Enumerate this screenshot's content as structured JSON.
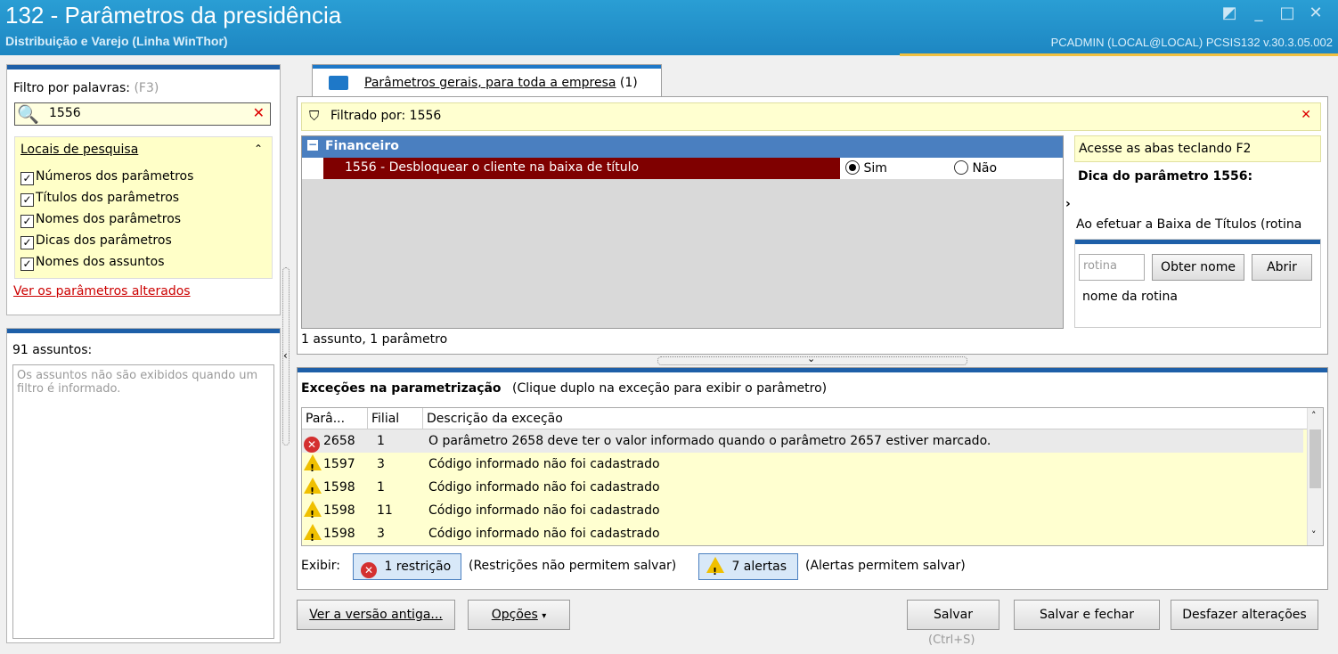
{
  "window": {
    "title": "132 - Parâmetros da presidência",
    "subtitle": "Distribuição e Varejo (Linha WinThor)",
    "user_info": "PCADMIN (LOCAL@LOCAL)   PCSIS132  v.30.3.05.002"
  },
  "filter": {
    "label": "Filtro por palavras:",
    "shortcut": "(F3)",
    "value": "1556",
    "search_places_label": "Locais de pesquisa",
    "options": [
      {
        "label": "Números dos parâmetros",
        "checked": true
      },
      {
        "label": "Títulos dos parâmetros",
        "checked": true
      },
      {
        "label": "Nomes dos parâmetros",
        "checked": true
      },
      {
        "label": "Dicas dos parâmetros",
        "checked": true
      },
      {
        "label": "Nomes dos assuntos",
        "checked": true
      }
    ],
    "changed_link": "Ver os parâmetros alterados"
  },
  "subjects": {
    "count_label": "91 assuntos:",
    "message": "Os assuntos não são exibidos quando um filtro é informado."
  },
  "tab": {
    "label": "Parâmetros gerais, para toda a empresa",
    "count": "(1)"
  },
  "filterbar": {
    "text": "Filtrado por: 1556"
  },
  "tree": {
    "group": "Financeiro",
    "param_label": "1556 - Desbloquear o cliente na baixa de título",
    "yes": "Sim",
    "no": "Não",
    "status": "1 assunto, 1 parâmetro"
  },
  "hint": {
    "tabs_hint": "Acesse as abas teclando F2",
    "title": "Dica do parâmetro 1556:",
    "text": "Ao efetuar a Baixa de Títulos (rotina",
    "routine_placeholder": "rotina",
    "get_name_button": "Obter nome",
    "open_button": "Abrir",
    "routine_name": "nome da rotina"
  },
  "exceptions": {
    "title": "Exceções na parametrização",
    "subtitle": "(Clique duplo na exceção para exibir o parâmetro)",
    "columns": [
      "Parâ...",
      "Filial",
      "Descrição da exceção"
    ],
    "rows": [
      {
        "type": "error",
        "param": "2658",
        "filial": "1",
        "desc": "O parâmetro 2658 deve ter o valor informado quando o parâmetro 2657 estiver marcado."
      },
      {
        "type": "warning",
        "param": "1597",
        "filial": "3",
        "desc": "Código informado não foi cadastrado"
      },
      {
        "type": "warning",
        "param": "1598",
        "filial": "1",
        "desc": "Código informado não foi cadastrado"
      },
      {
        "type": "warning",
        "param": "1598",
        "filial": "11",
        "desc": "Código informado não foi cadastrado"
      },
      {
        "type": "warning",
        "param": "1598",
        "filial": "3",
        "desc": "Código informado não foi cadastrado"
      }
    ],
    "show_label": "Exibir:",
    "restrictions_button": "1 restrição",
    "restrictions_note": "(Restrições não permitem salvar)",
    "alerts_button": "7 alertas",
    "alerts_note": "(Alertas permitem salvar)"
  },
  "footer": {
    "old_version": "Ver a versão antiga...",
    "options": "Opções",
    "save": "Salvar",
    "save_shortcut": "(Ctrl+S)",
    "save_close": "Salvar e fechar",
    "undo": "Desfazer alterações"
  }
}
